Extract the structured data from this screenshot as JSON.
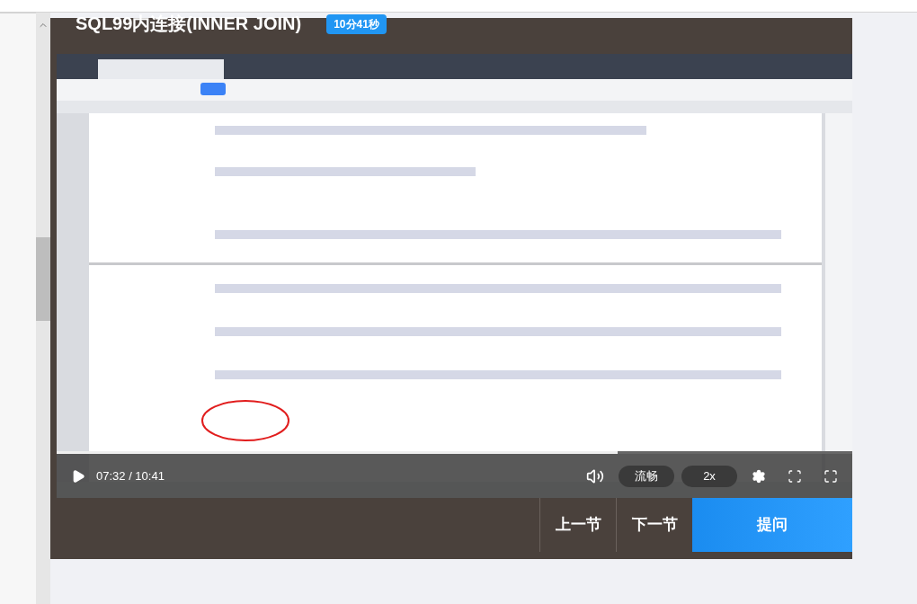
{
  "lesson": {
    "title": "SQL99内连接(INNER JOIN)",
    "duration_badge": "10分41秒"
  },
  "video": {
    "kind": "picture",
    "playing": false,
    "time": "07:32 / 10:41",
    "progress": {
      "level": 0.705
    },
    "quality": "流畅",
    "speed": "2x"
  },
  "nav_buttons": [
    {
      "label": "上一节",
      "kind": "plain"
    },
    {
      "label": "下一节",
      "kind": "plain"
    },
    {
      "label": "提问",
      "kind": "primary"
    }
  ]
}
